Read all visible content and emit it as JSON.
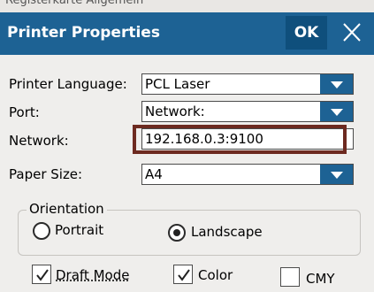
{
  "background_label": "Registerkarte Allgemein",
  "dialog": {
    "title": "Printer Properties",
    "ok_label": "OK"
  },
  "fields": {
    "printer_language": {
      "label": "Printer Language:",
      "value": "PCL Laser"
    },
    "port": {
      "label": "Port:",
      "value": "Network:"
    },
    "network": {
      "label": "Network:",
      "value": "192.168.0.3:9100"
    },
    "paper_size": {
      "label": "Paper Size:",
      "value": "A4"
    }
  },
  "orientation": {
    "legend": "Orientation",
    "options": [
      {
        "label": "Portrait",
        "selected": false
      },
      {
        "label": "Landscape",
        "selected": true
      }
    ]
  },
  "checkboxes": [
    {
      "label": "Draft Mode",
      "checked": true
    },
    {
      "label": "Color",
      "checked": true
    },
    {
      "label": "CMY",
      "checked": false
    }
  ],
  "colors": {
    "titlebar": "#1d6294",
    "ok_button": "#0f4f7c",
    "dropdown_arrow": "#1d6294",
    "highlight_border": "#6d2a20",
    "panel": "#efeeec"
  },
  "icons": {
    "close": "close-icon",
    "dropdown": "chevron-down-icon",
    "check": "checkmark-icon"
  }
}
